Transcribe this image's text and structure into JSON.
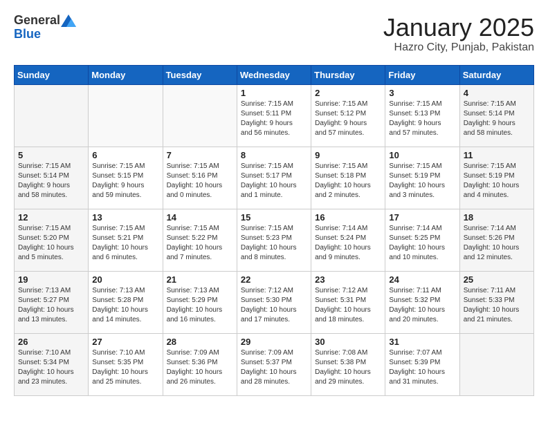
{
  "header": {
    "logo_line1": "General",
    "logo_line2": "Blue",
    "title": "January 2025",
    "subtitle": "Hazro City, Punjab, Pakistan"
  },
  "days_of_week": [
    "Sunday",
    "Monday",
    "Tuesday",
    "Wednesday",
    "Thursday",
    "Friday",
    "Saturday"
  ],
  "weeks": [
    [
      {
        "day": "",
        "info": ""
      },
      {
        "day": "",
        "info": ""
      },
      {
        "day": "",
        "info": ""
      },
      {
        "day": "1",
        "info": "Sunrise: 7:15 AM\nSunset: 5:11 PM\nDaylight: 9 hours\nand 56 minutes."
      },
      {
        "day": "2",
        "info": "Sunrise: 7:15 AM\nSunset: 5:12 PM\nDaylight: 9 hours\nand 57 minutes."
      },
      {
        "day": "3",
        "info": "Sunrise: 7:15 AM\nSunset: 5:13 PM\nDaylight: 9 hours\nand 57 minutes."
      },
      {
        "day": "4",
        "info": "Sunrise: 7:15 AM\nSunset: 5:14 PM\nDaylight: 9 hours\nand 58 minutes."
      }
    ],
    [
      {
        "day": "5",
        "info": "Sunrise: 7:15 AM\nSunset: 5:14 PM\nDaylight: 9 hours\nand 58 minutes."
      },
      {
        "day": "6",
        "info": "Sunrise: 7:15 AM\nSunset: 5:15 PM\nDaylight: 9 hours\nand 59 minutes."
      },
      {
        "day": "7",
        "info": "Sunrise: 7:15 AM\nSunset: 5:16 PM\nDaylight: 10 hours\nand 0 minutes."
      },
      {
        "day": "8",
        "info": "Sunrise: 7:15 AM\nSunset: 5:17 PM\nDaylight: 10 hours\nand 1 minute."
      },
      {
        "day": "9",
        "info": "Sunrise: 7:15 AM\nSunset: 5:18 PM\nDaylight: 10 hours\nand 2 minutes."
      },
      {
        "day": "10",
        "info": "Sunrise: 7:15 AM\nSunset: 5:19 PM\nDaylight: 10 hours\nand 3 minutes."
      },
      {
        "day": "11",
        "info": "Sunrise: 7:15 AM\nSunset: 5:19 PM\nDaylight: 10 hours\nand 4 minutes."
      }
    ],
    [
      {
        "day": "12",
        "info": "Sunrise: 7:15 AM\nSunset: 5:20 PM\nDaylight: 10 hours\nand 5 minutes."
      },
      {
        "day": "13",
        "info": "Sunrise: 7:15 AM\nSunset: 5:21 PM\nDaylight: 10 hours\nand 6 minutes."
      },
      {
        "day": "14",
        "info": "Sunrise: 7:15 AM\nSunset: 5:22 PM\nDaylight: 10 hours\nand 7 minutes."
      },
      {
        "day": "15",
        "info": "Sunrise: 7:15 AM\nSunset: 5:23 PM\nDaylight: 10 hours\nand 8 minutes."
      },
      {
        "day": "16",
        "info": "Sunrise: 7:14 AM\nSunset: 5:24 PM\nDaylight: 10 hours\nand 9 minutes."
      },
      {
        "day": "17",
        "info": "Sunrise: 7:14 AM\nSunset: 5:25 PM\nDaylight: 10 hours\nand 10 minutes."
      },
      {
        "day": "18",
        "info": "Sunrise: 7:14 AM\nSunset: 5:26 PM\nDaylight: 10 hours\nand 12 minutes."
      }
    ],
    [
      {
        "day": "19",
        "info": "Sunrise: 7:13 AM\nSunset: 5:27 PM\nDaylight: 10 hours\nand 13 minutes."
      },
      {
        "day": "20",
        "info": "Sunrise: 7:13 AM\nSunset: 5:28 PM\nDaylight: 10 hours\nand 14 minutes."
      },
      {
        "day": "21",
        "info": "Sunrise: 7:13 AM\nSunset: 5:29 PM\nDaylight: 10 hours\nand 16 minutes."
      },
      {
        "day": "22",
        "info": "Sunrise: 7:12 AM\nSunset: 5:30 PM\nDaylight: 10 hours\nand 17 minutes."
      },
      {
        "day": "23",
        "info": "Sunrise: 7:12 AM\nSunset: 5:31 PM\nDaylight: 10 hours\nand 18 minutes."
      },
      {
        "day": "24",
        "info": "Sunrise: 7:11 AM\nSunset: 5:32 PM\nDaylight: 10 hours\nand 20 minutes."
      },
      {
        "day": "25",
        "info": "Sunrise: 7:11 AM\nSunset: 5:33 PM\nDaylight: 10 hours\nand 21 minutes."
      }
    ],
    [
      {
        "day": "26",
        "info": "Sunrise: 7:10 AM\nSunset: 5:34 PM\nDaylight: 10 hours\nand 23 minutes."
      },
      {
        "day": "27",
        "info": "Sunrise: 7:10 AM\nSunset: 5:35 PM\nDaylight: 10 hours\nand 25 minutes."
      },
      {
        "day": "28",
        "info": "Sunrise: 7:09 AM\nSunset: 5:36 PM\nDaylight: 10 hours\nand 26 minutes."
      },
      {
        "day": "29",
        "info": "Sunrise: 7:09 AM\nSunset: 5:37 PM\nDaylight: 10 hours\nand 28 minutes."
      },
      {
        "day": "30",
        "info": "Sunrise: 7:08 AM\nSunset: 5:38 PM\nDaylight: 10 hours\nand 29 minutes."
      },
      {
        "day": "31",
        "info": "Sunrise: 7:07 AM\nSunset: 5:39 PM\nDaylight: 10 hours\nand 31 minutes."
      },
      {
        "day": "",
        "info": ""
      }
    ]
  ]
}
